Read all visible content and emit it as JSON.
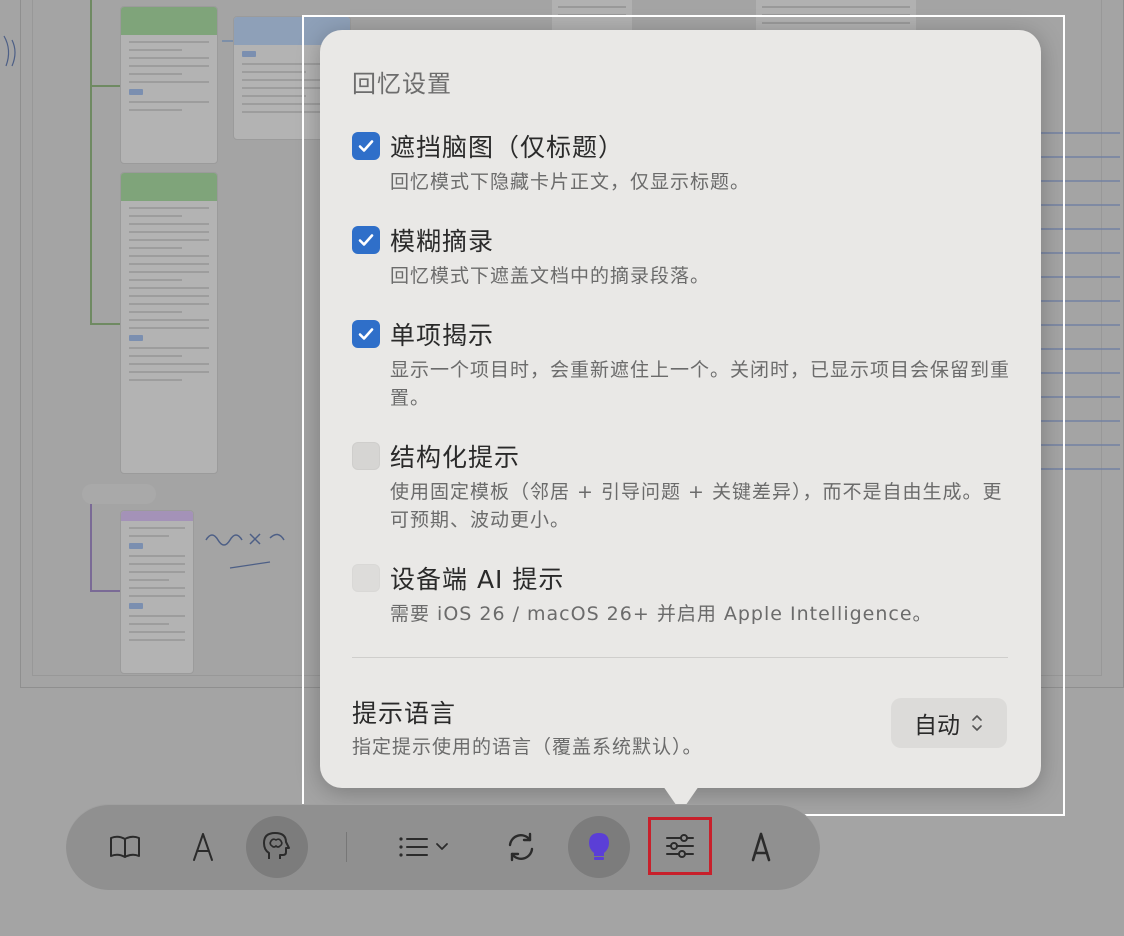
{
  "popover": {
    "title": "回忆设置",
    "options": [
      {
        "label": "遮挡脑图（仅标题）",
        "description": "回忆模式下隐藏卡片正文，仅显示标题。",
        "checked": true
      },
      {
        "label": "模糊摘录",
        "description": "回忆模式下遮盖文档中的摘录段落。",
        "checked": true
      },
      {
        "label": "单项揭示",
        "description": "显示一个项目时，会重新遮住上一个。关闭时，已显示项目会保留到重置。",
        "checked": true
      },
      {
        "label": "结构化提示",
        "description": "使用固定模板（邻居 + 引导问题 + 关键差异），而不是自由生成。更可预期、波动更小。",
        "checked": false
      },
      {
        "label": "设备端 AI 提示",
        "description": "需要 iOS 26 / macOS 26+ 并启用 Apple Intelligence。",
        "checked": false,
        "disabled": true
      }
    ],
    "language": {
      "title": "提示语言",
      "description": "指定提示使用的语言（覆盖系统默认）。",
      "value": "自动"
    }
  },
  "toolbar": {
    "buttons": [
      {
        "icon": "book-icon",
        "active": false
      },
      {
        "icon": "compass-icon",
        "active": false
      },
      {
        "icon": "brain-head-icon",
        "active": true
      },
      {
        "icon": "list-dropdown-icon",
        "active": false
      },
      {
        "icon": "sync-icon",
        "active": false
      },
      {
        "icon": "lightbulb-icon",
        "active": true,
        "accent": "#5b3fd6"
      },
      {
        "icon": "sliders-icon",
        "active": false,
        "highlighted": true
      },
      {
        "icon": "compass-icon",
        "active": false
      }
    ]
  },
  "colors": {
    "checkbox_on": "#2f6fc9",
    "highlight_box": "#c8202b"
  }
}
